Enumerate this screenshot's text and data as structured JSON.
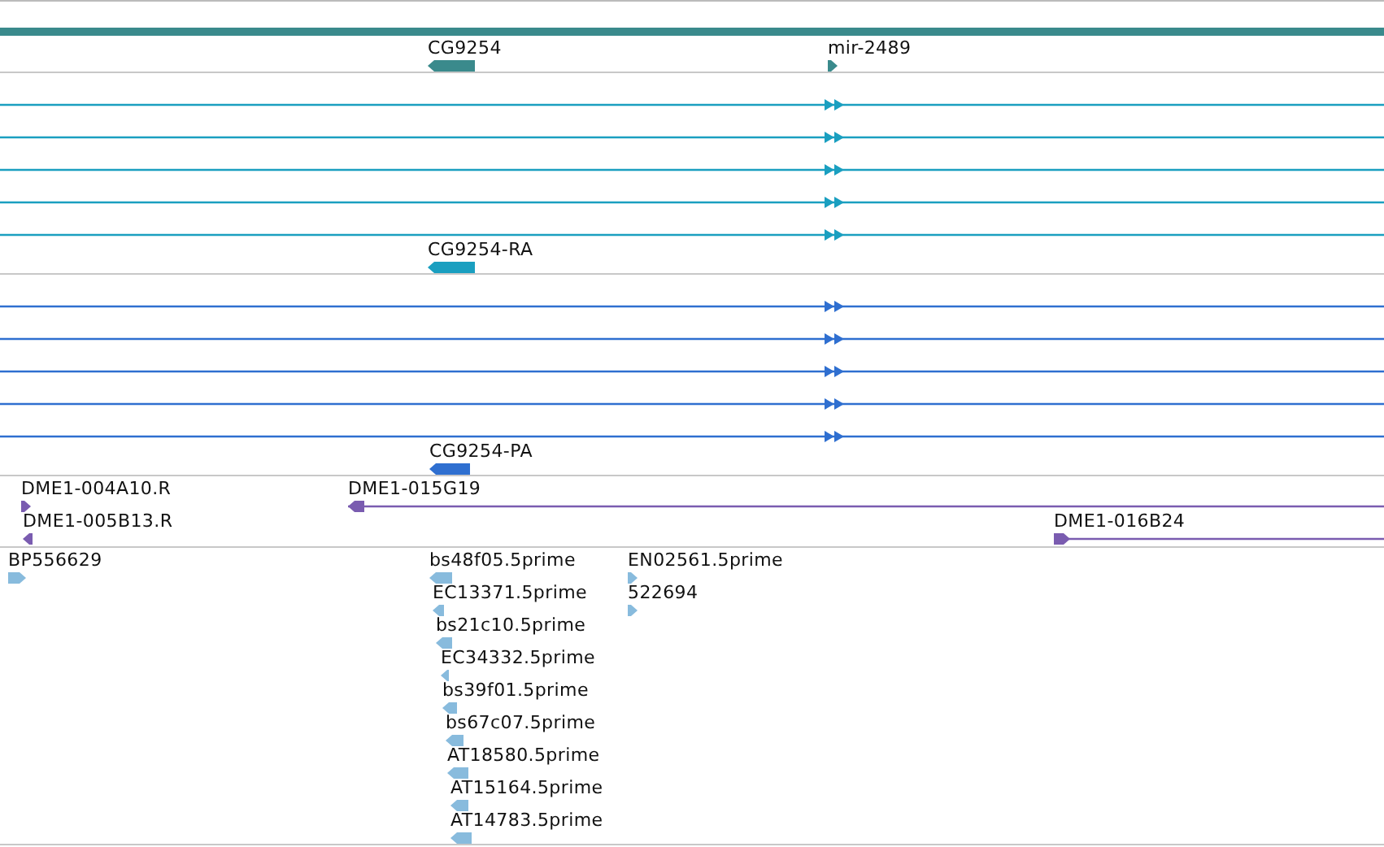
{
  "tracks": [
    {
      "kind": "genes",
      "color": "#3a8a8c",
      "features": [
        {
          "label": "CG9254",
          "reverse": true
        },
        {
          "label": "mir-2489",
          "reverse": false
        }
      ]
    },
    {
      "kind": "transcripts",
      "color": "#1a9fc0",
      "rows": [
        {
          "reverse": false
        },
        {
          "reverse": false
        },
        {
          "reverse": false
        },
        {
          "reverse": false
        },
        {
          "reverse": false
        }
      ],
      "features": [
        {
          "label": "CG9254-RA",
          "reverse": true
        }
      ]
    },
    {
      "kind": "transcripts",
      "color": "#2f6fd0",
      "rows": [
        {
          "reverse": false
        },
        {
          "reverse": false
        },
        {
          "reverse": false
        },
        {
          "reverse": false
        },
        {
          "reverse": false
        }
      ],
      "features": [
        {
          "label": "CG9254-PA",
          "reverse": true
        }
      ]
    },
    {
      "kind": "clones",
      "color": "#7a5cb0",
      "features": [
        {
          "label": "DME1-004A10.R",
          "reverse": false,
          "kind": "end"
        },
        {
          "label": "DME1-015G19",
          "reverse": true,
          "kind": "span"
        },
        {
          "label": "DME1-005B13.R",
          "reverse": true,
          "kind": "end"
        },
        {
          "label": "DME1-016B24",
          "reverse": false,
          "kind": "span"
        }
      ]
    },
    {
      "kind": "ests",
      "color": "#88bbdd",
      "features": [
        {
          "label": "BP556629",
          "reverse": false
        },
        {
          "label": "bs48f05.5prime",
          "reverse": true
        },
        {
          "label": "EN02561.5prime",
          "reverse": false
        },
        {
          "label": "EC13371.5prime",
          "reverse": true
        },
        {
          "label": "522694",
          "reverse": false
        },
        {
          "label": "bs21c10.5prime",
          "reverse": true
        },
        {
          "label": "EC34332.5prime",
          "reverse": true
        },
        {
          "label": "bs39f01.5prime",
          "reverse": true
        },
        {
          "label": "bs67c07.5prime",
          "reverse": true
        },
        {
          "label": "AT18580.5prime",
          "reverse": true
        },
        {
          "label": "AT15164.5prime",
          "reverse": true
        },
        {
          "label": "AT14783.5prime",
          "reverse": true
        }
      ]
    }
  ]
}
